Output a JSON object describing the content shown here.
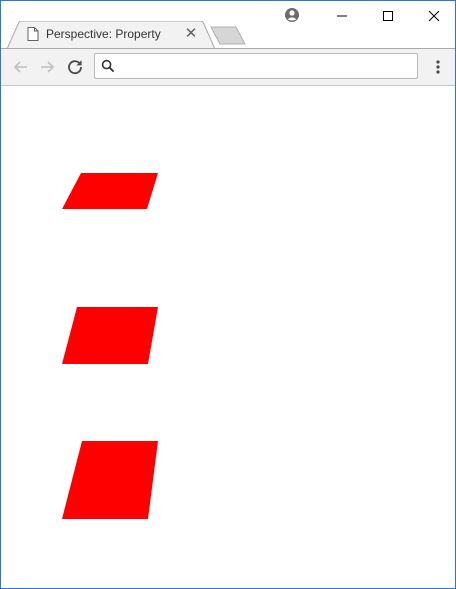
{
  "browser": {
    "tab": {
      "title": "Perspective: Property",
      "close_glyph": "✕",
      "icon": "page-icon"
    },
    "new_tab_icon": "new-tab-icon",
    "window_controls": [
      "minimize-icon",
      "maximize-icon",
      "close-icon"
    ],
    "profile_icon": "profile-icon",
    "toolbar": {
      "back_icon": "back-arrow-icon",
      "forward_icon": "forward-arrow-icon",
      "reload_icon": "reload-icon",
      "menu_icon": "kebab-menu-icon"
    },
    "omnibox": {
      "value": "",
      "placeholder": "",
      "icon": "search-icon"
    }
  },
  "page": {
    "shapes": [
      {
        "name": "perspective-parallelogram-1",
        "color": "#ff0000"
      },
      {
        "name": "perspective-parallelogram-2",
        "color": "#ff0000"
      },
      {
        "name": "perspective-parallelogram-3",
        "color": "#ff0000"
      }
    ]
  }
}
